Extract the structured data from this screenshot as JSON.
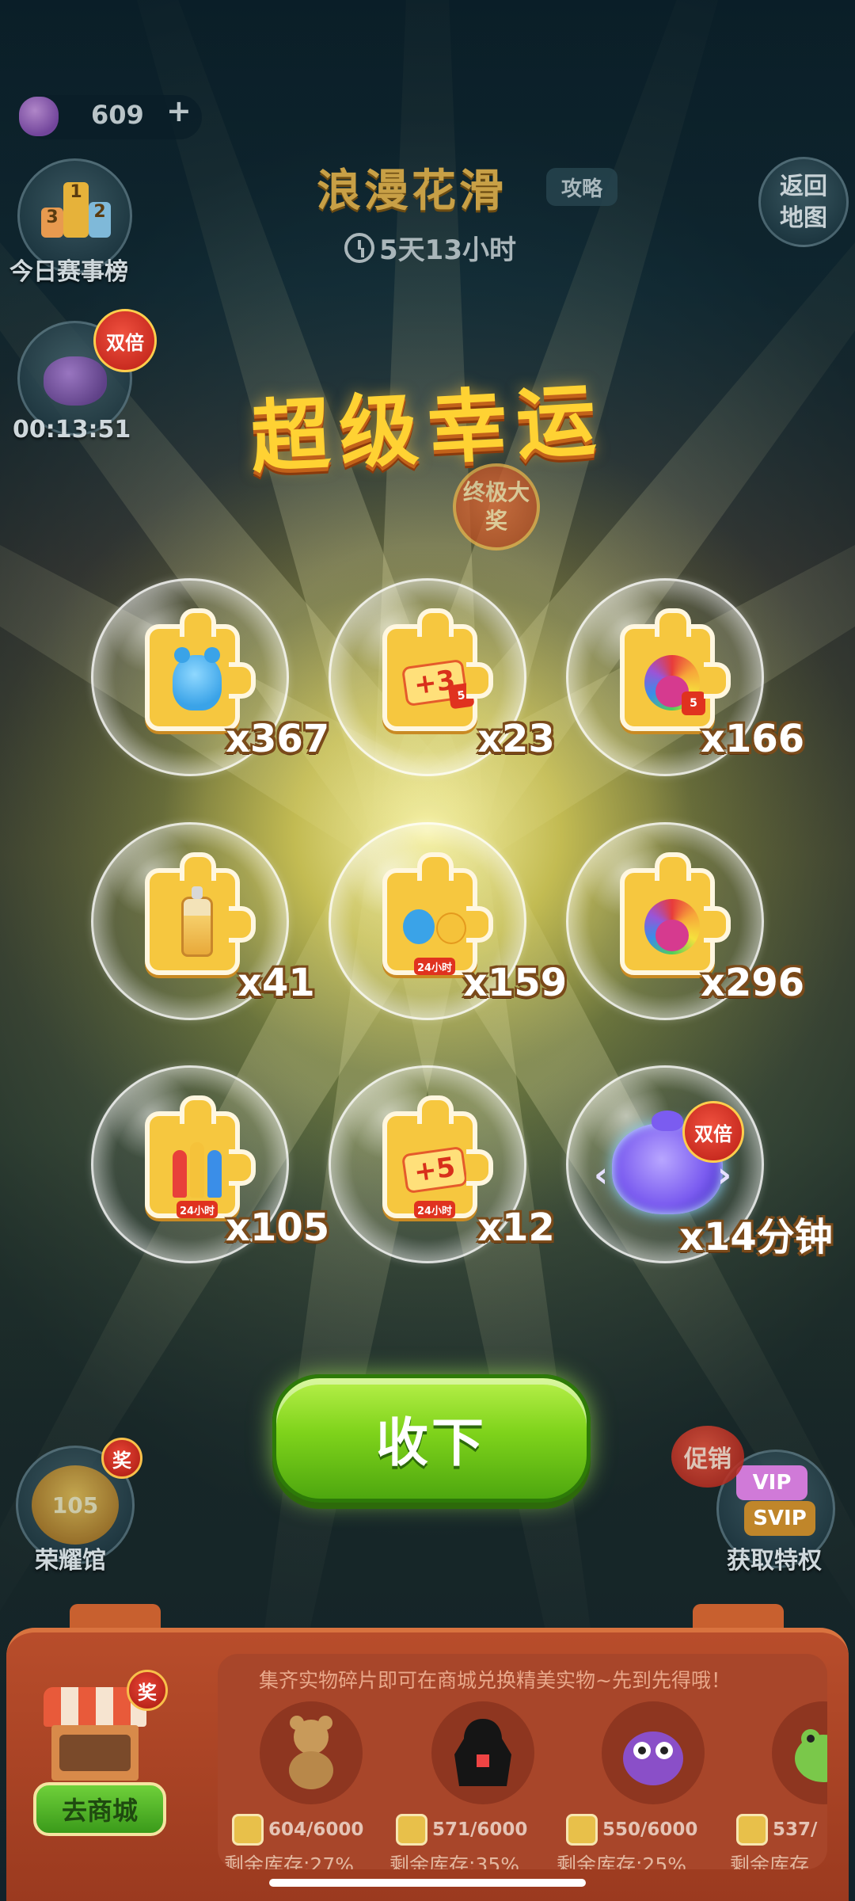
{
  "hud": {
    "coins": "609",
    "coins_plus": "+",
    "rank_board_label": "今日赛事榜",
    "podium": [
      "1",
      "2",
      "3"
    ],
    "double_label": "双倍",
    "double_timer": "00:13:51",
    "return_label_line1": "返回",
    "return_label_line2": "地图"
  },
  "event": {
    "title": "浪漫花滑",
    "strategy": "攻略",
    "countdown": "5天13小时"
  },
  "popup": {
    "title": "超级幸运",
    "grand_prize": "终极大奖",
    "rewards": [
      {
        "icon": "blue-bear-puzzle-icon",
        "amount": "x367"
      },
      {
        "icon": "plus3-moves-puzzle-icon",
        "amount": "x23",
        "art_text": "+3",
        "badge": "5"
      },
      {
        "icon": "rainbow-bird-puzzle-icon",
        "amount": "x166",
        "badge": "5"
      },
      {
        "icon": "bottle-puzzle-icon",
        "amount": "x41"
      },
      {
        "icon": "duo-pets-puzzle-icon",
        "amount": "x159",
        "badge": "24小时"
      },
      {
        "icon": "rainbow-bird-puzzle-icon",
        "amount": "x296"
      },
      {
        "icon": "rockets-puzzle-icon",
        "amount": "x105",
        "badge": "24小时"
      },
      {
        "icon": "plus5-moves-puzzle-icon",
        "amount": "x12",
        "art_text": "+5",
        "badge": "24小时"
      },
      {
        "icon": "double-blob-icon",
        "amount": "x14分钟",
        "badge": "双倍"
      }
    ],
    "collect_label": "收下"
  },
  "bottom": {
    "honor_hall_label": "荣耀馆",
    "honor_badge": "奖",
    "promo_label": "促销",
    "vip_label": "VIP",
    "svip_label": "SVIP",
    "privilege_label": "获取特权"
  },
  "shop": {
    "badge": "奖",
    "go_shop_label": "去商城",
    "note": "集齐实物碎片即可在商城兑换精美实物~先到先得哦！",
    "prizes": [
      {
        "icon": "teddy-bear-icon",
        "count": "604/6000",
        "stock": "剩余库存:27%"
      },
      {
        "icon": "black-hoodie-icon",
        "count": "571/6000",
        "stock": "剩余库存:35%"
      },
      {
        "icon": "purple-owl-plush-icon",
        "count": "550/6000",
        "stock": "剩余库存:25%"
      },
      {
        "icon": "green-frog-plush-icon",
        "count": "537/",
        "stock": "剩余库存"
      }
    ]
  },
  "colors": {
    "title_gold": "#ffd233",
    "collect_green": "#7fd31b",
    "panel_red": "#b84d2b",
    "badge_red": "#e0321f"
  }
}
